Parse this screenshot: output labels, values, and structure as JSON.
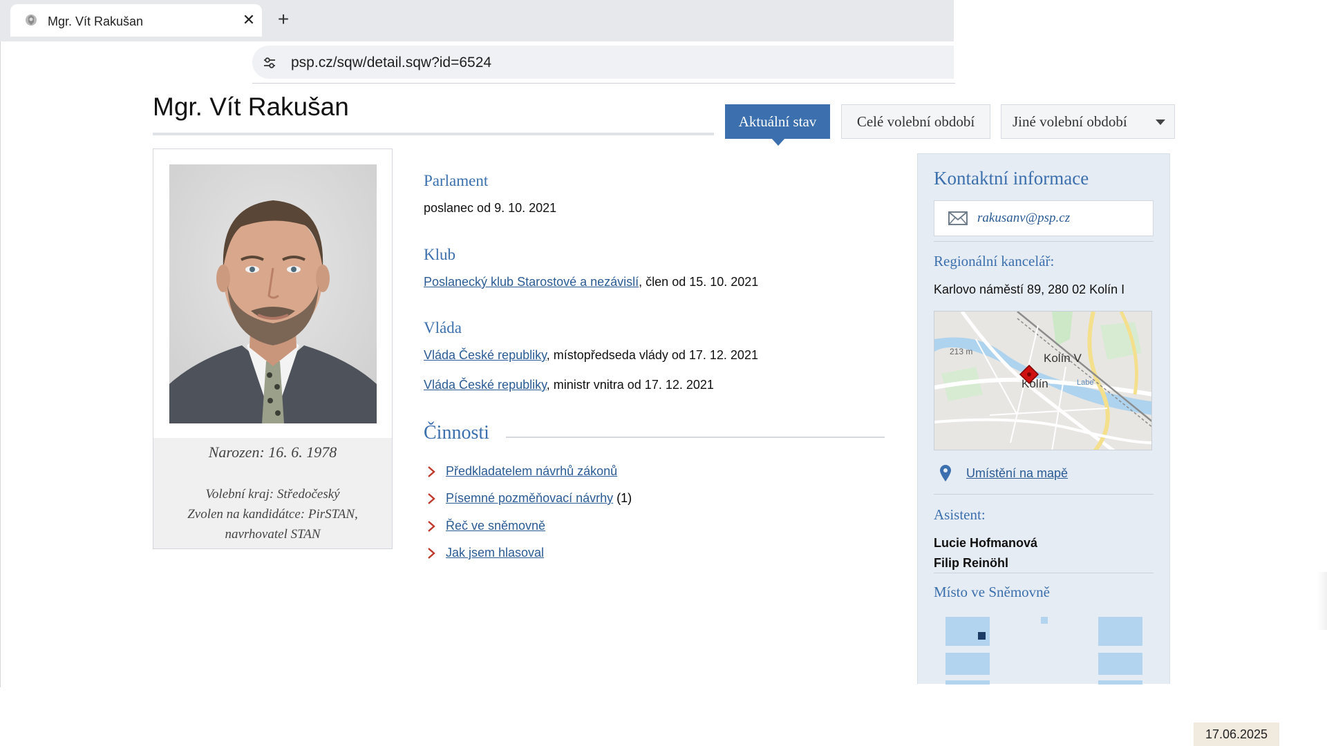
{
  "browser": {
    "tab_title": "Mgr. Vít Rakušan",
    "tab_close": "✕",
    "new_tab": "+",
    "url": "psp.cz/sqw/detail.sqw?id=6524"
  },
  "page": {
    "title": "Mgr. Vít Rakušan",
    "tabs": {
      "current": "Aktuální stav",
      "full_term": "Celé volební období",
      "other_term": "Jiné volební období"
    }
  },
  "profile": {
    "born": "Narozen: 16. 6. 1978",
    "region": "Volební kraj: Středočeský",
    "candidacy": "Zvolen na kandidátce: PirSTAN,",
    "nominator": "navrhovatel STAN"
  },
  "sections": {
    "parlament": {
      "heading": "Parlament",
      "text": "poslanec od 9. 10. 2021"
    },
    "klub": {
      "heading": "Klub",
      "link": "Poslanecký klub Starostové a nezávislí",
      "suffix": ", člen od 15. 10. 2021"
    },
    "vlada": {
      "heading": "Vláda",
      "items": [
        {
          "link": "Vláda České republiky",
          "suffix": ", místopředseda vlády od 17. 12. 2021"
        },
        {
          "link": "Vláda České republiky",
          "suffix": ", ministr vnitra od 17. 12. 2021"
        }
      ]
    },
    "cinnosti": {
      "heading": "Činnosti",
      "items": [
        {
          "link": "Předkladatelem návrhů zákonů",
          "suffix": ""
        },
        {
          "link": "Písemné pozměňovací návrhy",
          "suffix": " (1)"
        },
        {
          "link": "Řeč ve sněmovně",
          "suffix": ""
        },
        {
          "link": "Jak jsem hlasoval",
          "suffix": ""
        }
      ]
    }
  },
  "contact": {
    "heading": "Kontaktní informace",
    "email": "rakusanv@psp.cz",
    "office_label": "Regionální kancelář:",
    "office_address": "Karlovo náměstí 89, 280 02  Kolín I",
    "map": {
      "label_elev": "213 m",
      "label_kolin_v": "Kolín V",
      "label_kolin": "Kolín",
      "label_river": "Labe"
    },
    "map_link": "Umístění na mapě",
    "assistant_label": "Asistent:",
    "assistants": [
      "Lucie Hofmanová",
      "Filip Reinöhl"
    ],
    "seat_label": "Místo ve Sněmovně"
  },
  "footer_date": "17.06.2025",
  "colors": {
    "accent": "#3b6fad",
    "link": "#2a5b94",
    "panel": "#e6ecf3",
    "chevron": "#c0392b",
    "pin": "#3b6fad"
  },
  "icons": [
    "favicon-emblem-icon",
    "close-icon",
    "plus-icon",
    "site-settings-icon",
    "caret-down-icon",
    "envelope-icon",
    "map-pin-icon",
    "chevron-right-icon"
  ]
}
